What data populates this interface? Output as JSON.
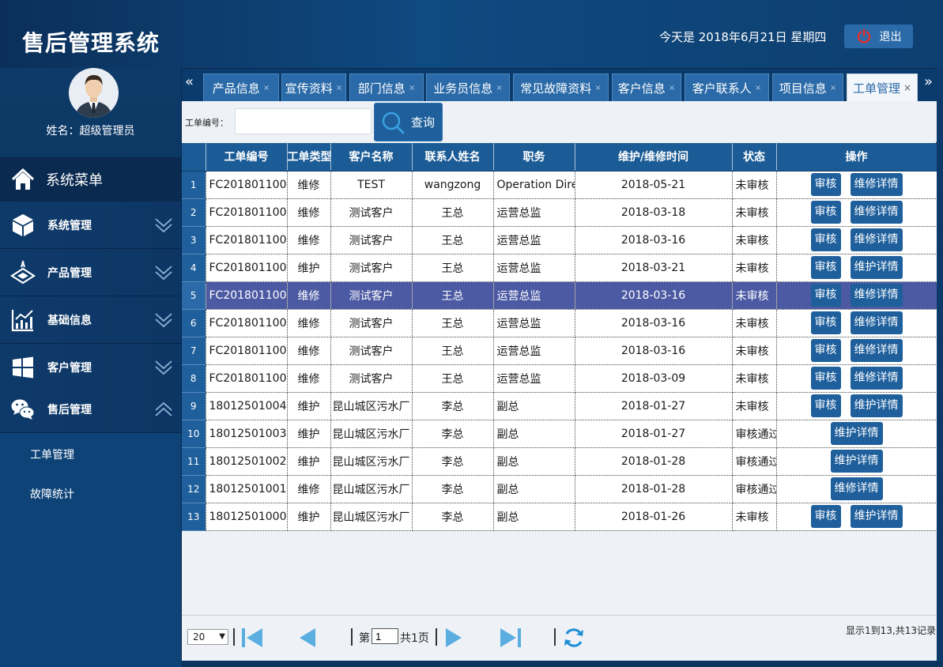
{
  "header": {
    "title": "售后管理系统",
    "date": "今天是 2018年6月21日 星期四",
    "logout_label": "退出"
  },
  "profile": {
    "name": "姓名：超级管理员"
  },
  "sidebar": {
    "menu_title": "系统菜单",
    "items": [
      {
        "label": "系统管理",
        "icon": "cube-icon"
      },
      {
        "label": "产品管理",
        "icon": "product-icon"
      },
      {
        "label": "基础信息",
        "icon": "chart-icon"
      },
      {
        "label": "客户管理",
        "icon": "windows-icon"
      },
      {
        "label": "售后管理",
        "icon": "wechat-icon"
      }
    ],
    "sub_items": [
      "工单管理",
      "故障统计"
    ]
  },
  "tabs": [
    {
      "label": "产品信息"
    },
    {
      "label": "宣传资料"
    },
    {
      "label": "部门信息"
    },
    {
      "label": "业务员信息"
    },
    {
      "label": "常见故障资料"
    },
    {
      "label": "客户信息"
    },
    {
      "label": "客户联系人"
    },
    {
      "label": "项目信息"
    },
    {
      "label": "工单管理",
      "active": true
    }
  ],
  "search": {
    "label": "工单编号：",
    "value": "",
    "button_label": "查询"
  },
  "table": {
    "columns": [
      "工单编号",
      "工单类型",
      "客户名称",
      "联系人姓名",
      "职务",
      "维护/维修时间",
      "状态",
      "操作"
    ],
    "rows": [
      {
        "no": "1",
        "id": "FC201801100",
        "type": "维修",
        "customer": "TEST",
        "contact": "wangzong",
        "title": "Operation Director",
        "date": "2018-05-21",
        "status": "未审核",
        "actions": [
          "审核",
          "维修详情"
        ]
      },
      {
        "no": "2",
        "id": "FC201801100",
        "type": "维修",
        "customer": "测试客户",
        "contact": "王总",
        "title": "运营总监",
        "date": "2018-03-18",
        "status": "未审核",
        "actions": [
          "审核",
          "维修详情"
        ]
      },
      {
        "no": "3",
        "id": "FC201801100",
        "type": "维修",
        "customer": "测试客户",
        "contact": "王总",
        "title": "运营总监",
        "date": "2018-03-16",
        "status": "未审核",
        "actions": [
          "审核",
          "维修详情"
        ]
      },
      {
        "no": "4",
        "id": "FC201801100",
        "type": "维护",
        "customer": "测试客户",
        "contact": "王总",
        "title": "运营总监",
        "date": "2018-03-21",
        "status": "未审核",
        "actions": [
          "审核",
          "维护详情"
        ]
      },
      {
        "no": "5",
        "id": "FC201801100",
        "type": "维修",
        "customer": "测试客户",
        "contact": "王总",
        "title": "运营总监",
        "date": "2018-03-16",
        "status": "未审核",
        "actions": [
          "审核",
          "维修详情"
        ],
        "selected": true
      },
      {
        "no": "6",
        "id": "FC201801100",
        "type": "维修",
        "customer": "测试客户",
        "contact": "王总",
        "title": "运营总监",
        "date": "2018-03-16",
        "status": "未审核",
        "actions": [
          "审核",
          "维修详情"
        ]
      },
      {
        "no": "7",
        "id": "FC201801100",
        "type": "维修",
        "customer": "测试客户",
        "contact": "王总",
        "title": "运营总监",
        "date": "2018-03-16",
        "status": "未审核",
        "actions": [
          "审核",
          "维修详情"
        ]
      },
      {
        "no": "8",
        "id": "FC201801100",
        "type": "维修",
        "customer": "测试客户",
        "contact": "王总",
        "title": "运营总监",
        "date": "2018-03-09",
        "status": "未审核",
        "actions": [
          "审核",
          "维修详情"
        ]
      },
      {
        "no": "9",
        "id": "18012501004",
        "type": "维护",
        "customer": "昆山城区污水厂",
        "contact": "李总",
        "title": "副总",
        "date": "2018-01-27",
        "status": "未审核",
        "actions": [
          "审核",
          "维护详情"
        ]
      },
      {
        "no": "10",
        "id": "18012501003",
        "type": "维护",
        "customer": "昆山城区污水厂",
        "contact": "李总",
        "title": "副总",
        "date": "2018-01-27",
        "status": "审核通过",
        "actions": [
          "维护详情"
        ]
      },
      {
        "no": "11",
        "id": "18012501002",
        "type": "维护",
        "customer": "昆山城区污水厂",
        "contact": "李总",
        "title": "副总",
        "date": "2018-01-28",
        "status": "审核通过",
        "actions": [
          "维护详情"
        ]
      },
      {
        "no": "12",
        "id": "18012501001",
        "type": "维修",
        "customer": "昆山城区污水厂",
        "contact": "李总",
        "title": "副总",
        "date": "2018-01-28",
        "status": "审核通过",
        "actions": [
          "维修详情"
        ]
      },
      {
        "no": "13",
        "id": "18012501000",
        "type": "维护",
        "customer": "昆山城区污水厂",
        "contact": "李总",
        "title": "副总",
        "date": "2018-01-26",
        "status": "未审核",
        "actions": [
          "审核",
          "维护详情"
        ]
      }
    ]
  },
  "pager": {
    "page_size": "20",
    "page_prefix": "第",
    "page_value": "1",
    "page_suffix": "共1页",
    "info": "显示1到13,共13记录"
  },
  "colors": {
    "accent": "#1e5f9c",
    "selected_row": "#4c5aa3",
    "sidebar": "#0d3a68",
    "icon_blue": "#3aa0e0"
  }
}
